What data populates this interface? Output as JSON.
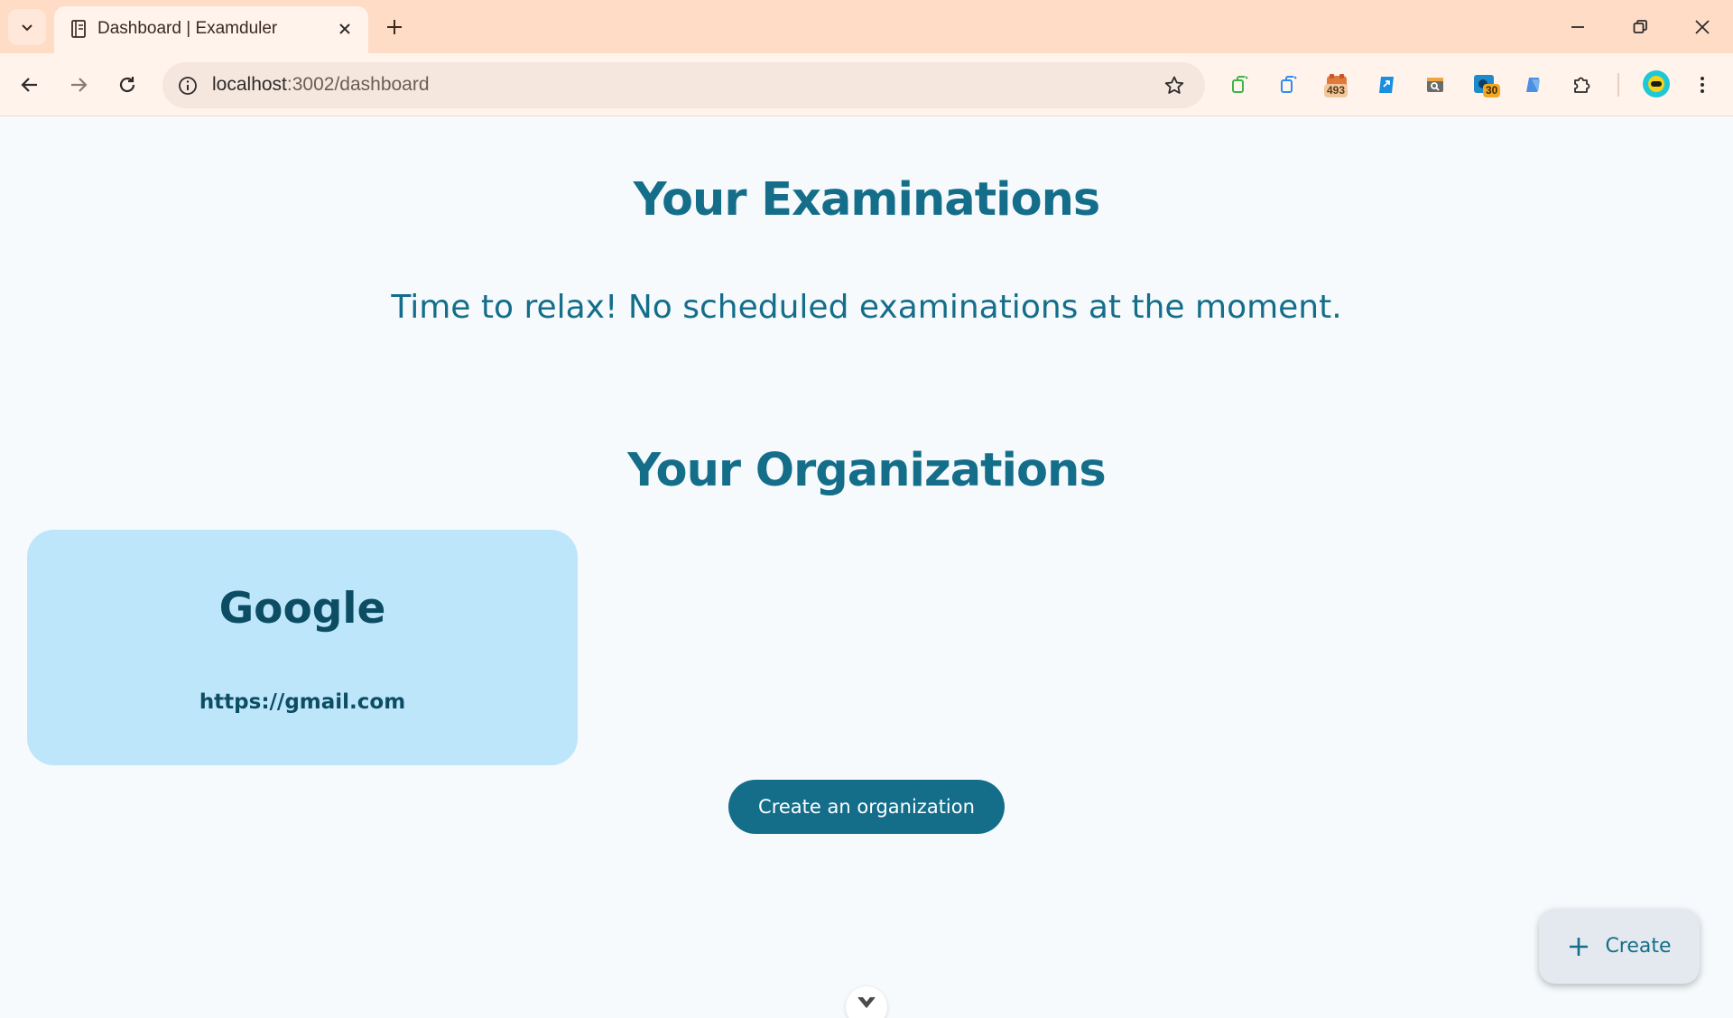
{
  "browser": {
    "tab": {
      "title": "Dashboard | Examduler"
    },
    "address": {
      "host": "localhost",
      "path": ":3002/dashboard"
    },
    "extensions": [
      {
        "name": "ext-copy-green-icon"
      },
      {
        "name": "ext-copy-blue-icon"
      },
      {
        "name": "ext-badge-493-icon",
        "badge": "493"
      },
      {
        "name": "ext-link-icon"
      },
      {
        "name": "ext-search-icon"
      },
      {
        "name": "ext-badge-30-icon",
        "badge": "30"
      },
      {
        "name": "ext-blue-doc-icon"
      },
      {
        "name": "extensions-puzzle-icon"
      }
    ]
  },
  "page": {
    "examinations_heading": "Your Examinations",
    "empty_message": "Time to relax! No scheduled examinations at the moment.",
    "organizations_heading": "Your Organizations",
    "organizations": [
      {
        "name": "Google",
        "url": "https://gmail.com"
      }
    ],
    "create_org_label": "Create an organization",
    "fab_label": "Create"
  },
  "colors": {
    "accent": "#146e8a",
    "card_bg": "#bde6fb",
    "tabbar_bg": "#ffdcc6",
    "page_bg": "#f6fafd"
  }
}
